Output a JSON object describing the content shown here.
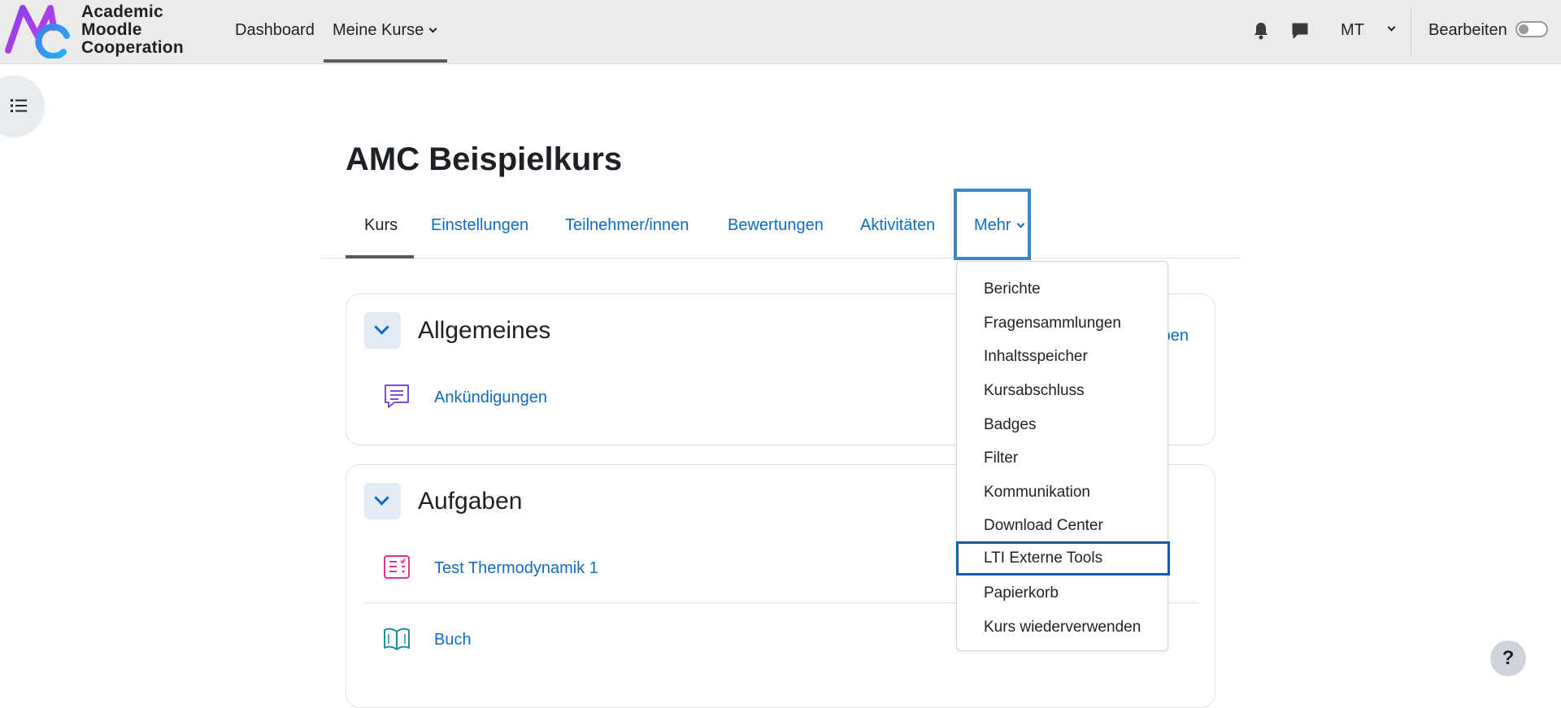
{
  "navbar": {
    "logo_lines": [
      "Academic",
      "Moodle",
      "Cooperation"
    ],
    "links": [
      "Dashboard",
      "Meine Kurse"
    ],
    "user_initials": "MT",
    "edit_mode_label": "Bearbeiten"
  },
  "course": {
    "title": "AMC Beispielkurs",
    "tabs": [
      "Kurs",
      "Einstellungen",
      "Teilnehmer/innen",
      "Bewertungen",
      "Aktivitäten",
      "Mehr"
    ]
  },
  "sections": [
    {
      "title": "Allgemeines",
      "right_link_partial": "pen",
      "activities": [
        {
          "name": "Ankündigungen",
          "icon": "forum-icon"
        }
      ]
    },
    {
      "title": "Aufgaben",
      "activities": [
        {
          "name": "Test Thermodynamik 1",
          "icon": "quiz-icon"
        },
        {
          "name": "Buch",
          "icon": "book-icon"
        }
      ]
    }
  ],
  "more_menu": {
    "items": [
      "Berichte",
      "Fragensammlungen",
      "Inhaltsspeicher",
      "Kursabschluss",
      "Badges",
      "Filter",
      "Kommunikation",
      "Download Center",
      "LTI Externe Tools",
      "Papierkorb",
      "Kurs wiederverwenden"
    ],
    "focused_item": "LTI Externe Tools"
  },
  "help": {
    "label": "?"
  },
  "colors": {
    "link": "#0f6cbf",
    "navbar_bg": "#ebebeb",
    "focus_ring": "#3d86c6",
    "quiz_icon": "#e6328c",
    "forum_icon": "#7a4ddc",
    "book_icon": "#1a8f9f"
  }
}
